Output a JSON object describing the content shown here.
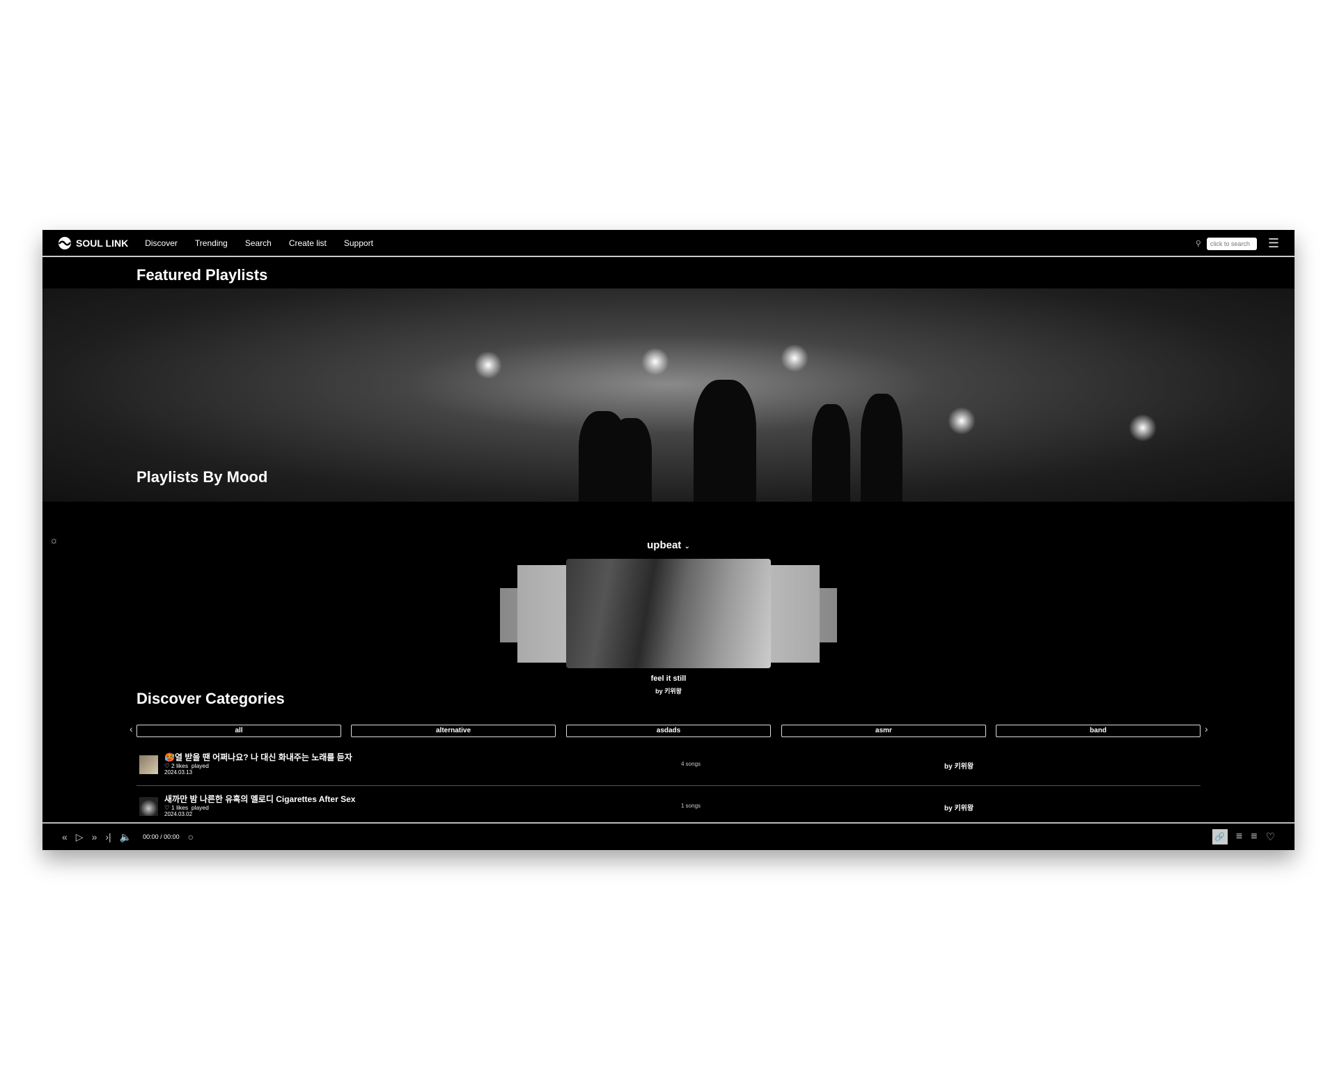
{
  "nav": {
    "brand": "SOUL LINK",
    "links": [
      "Discover",
      "Trending",
      "Search",
      "Create list",
      "Support"
    ],
    "search_placeholder": "click to search"
  },
  "featured": {
    "title": "Featured Playlists"
  },
  "mood": {
    "title": "Playlists By Mood",
    "selected": "upbeat",
    "card": {
      "title": "feel it still",
      "author": "by 키위왕"
    }
  },
  "discover": {
    "title": "Discover Categories",
    "categories": [
      "all",
      "alternative",
      "asdads",
      "asmr",
      "band"
    ],
    "rows": [
      {
        "title": "🥵열 받을 땐 어쩌나요? 나 대신 화내주는 노래를 듣자",
        "likes": "2 likes",
        "played": "played",
        "date": "2024.03.13",
        "songs": "4 songs",
        "author": "by 키위왕"
      },
      {
        "title": "새까만 밤 나른한 유혹의 멜로디 Cigarettes After Sex",
        "likes": "1 likes",
        "played": "played",
        "date": "2024.03.02",
        "songs": "1 songs",
        "author": "by 키위왕"
      }
    ]
  },
  "player": {
    "time": "00:00 / 00:00"
  }
}
